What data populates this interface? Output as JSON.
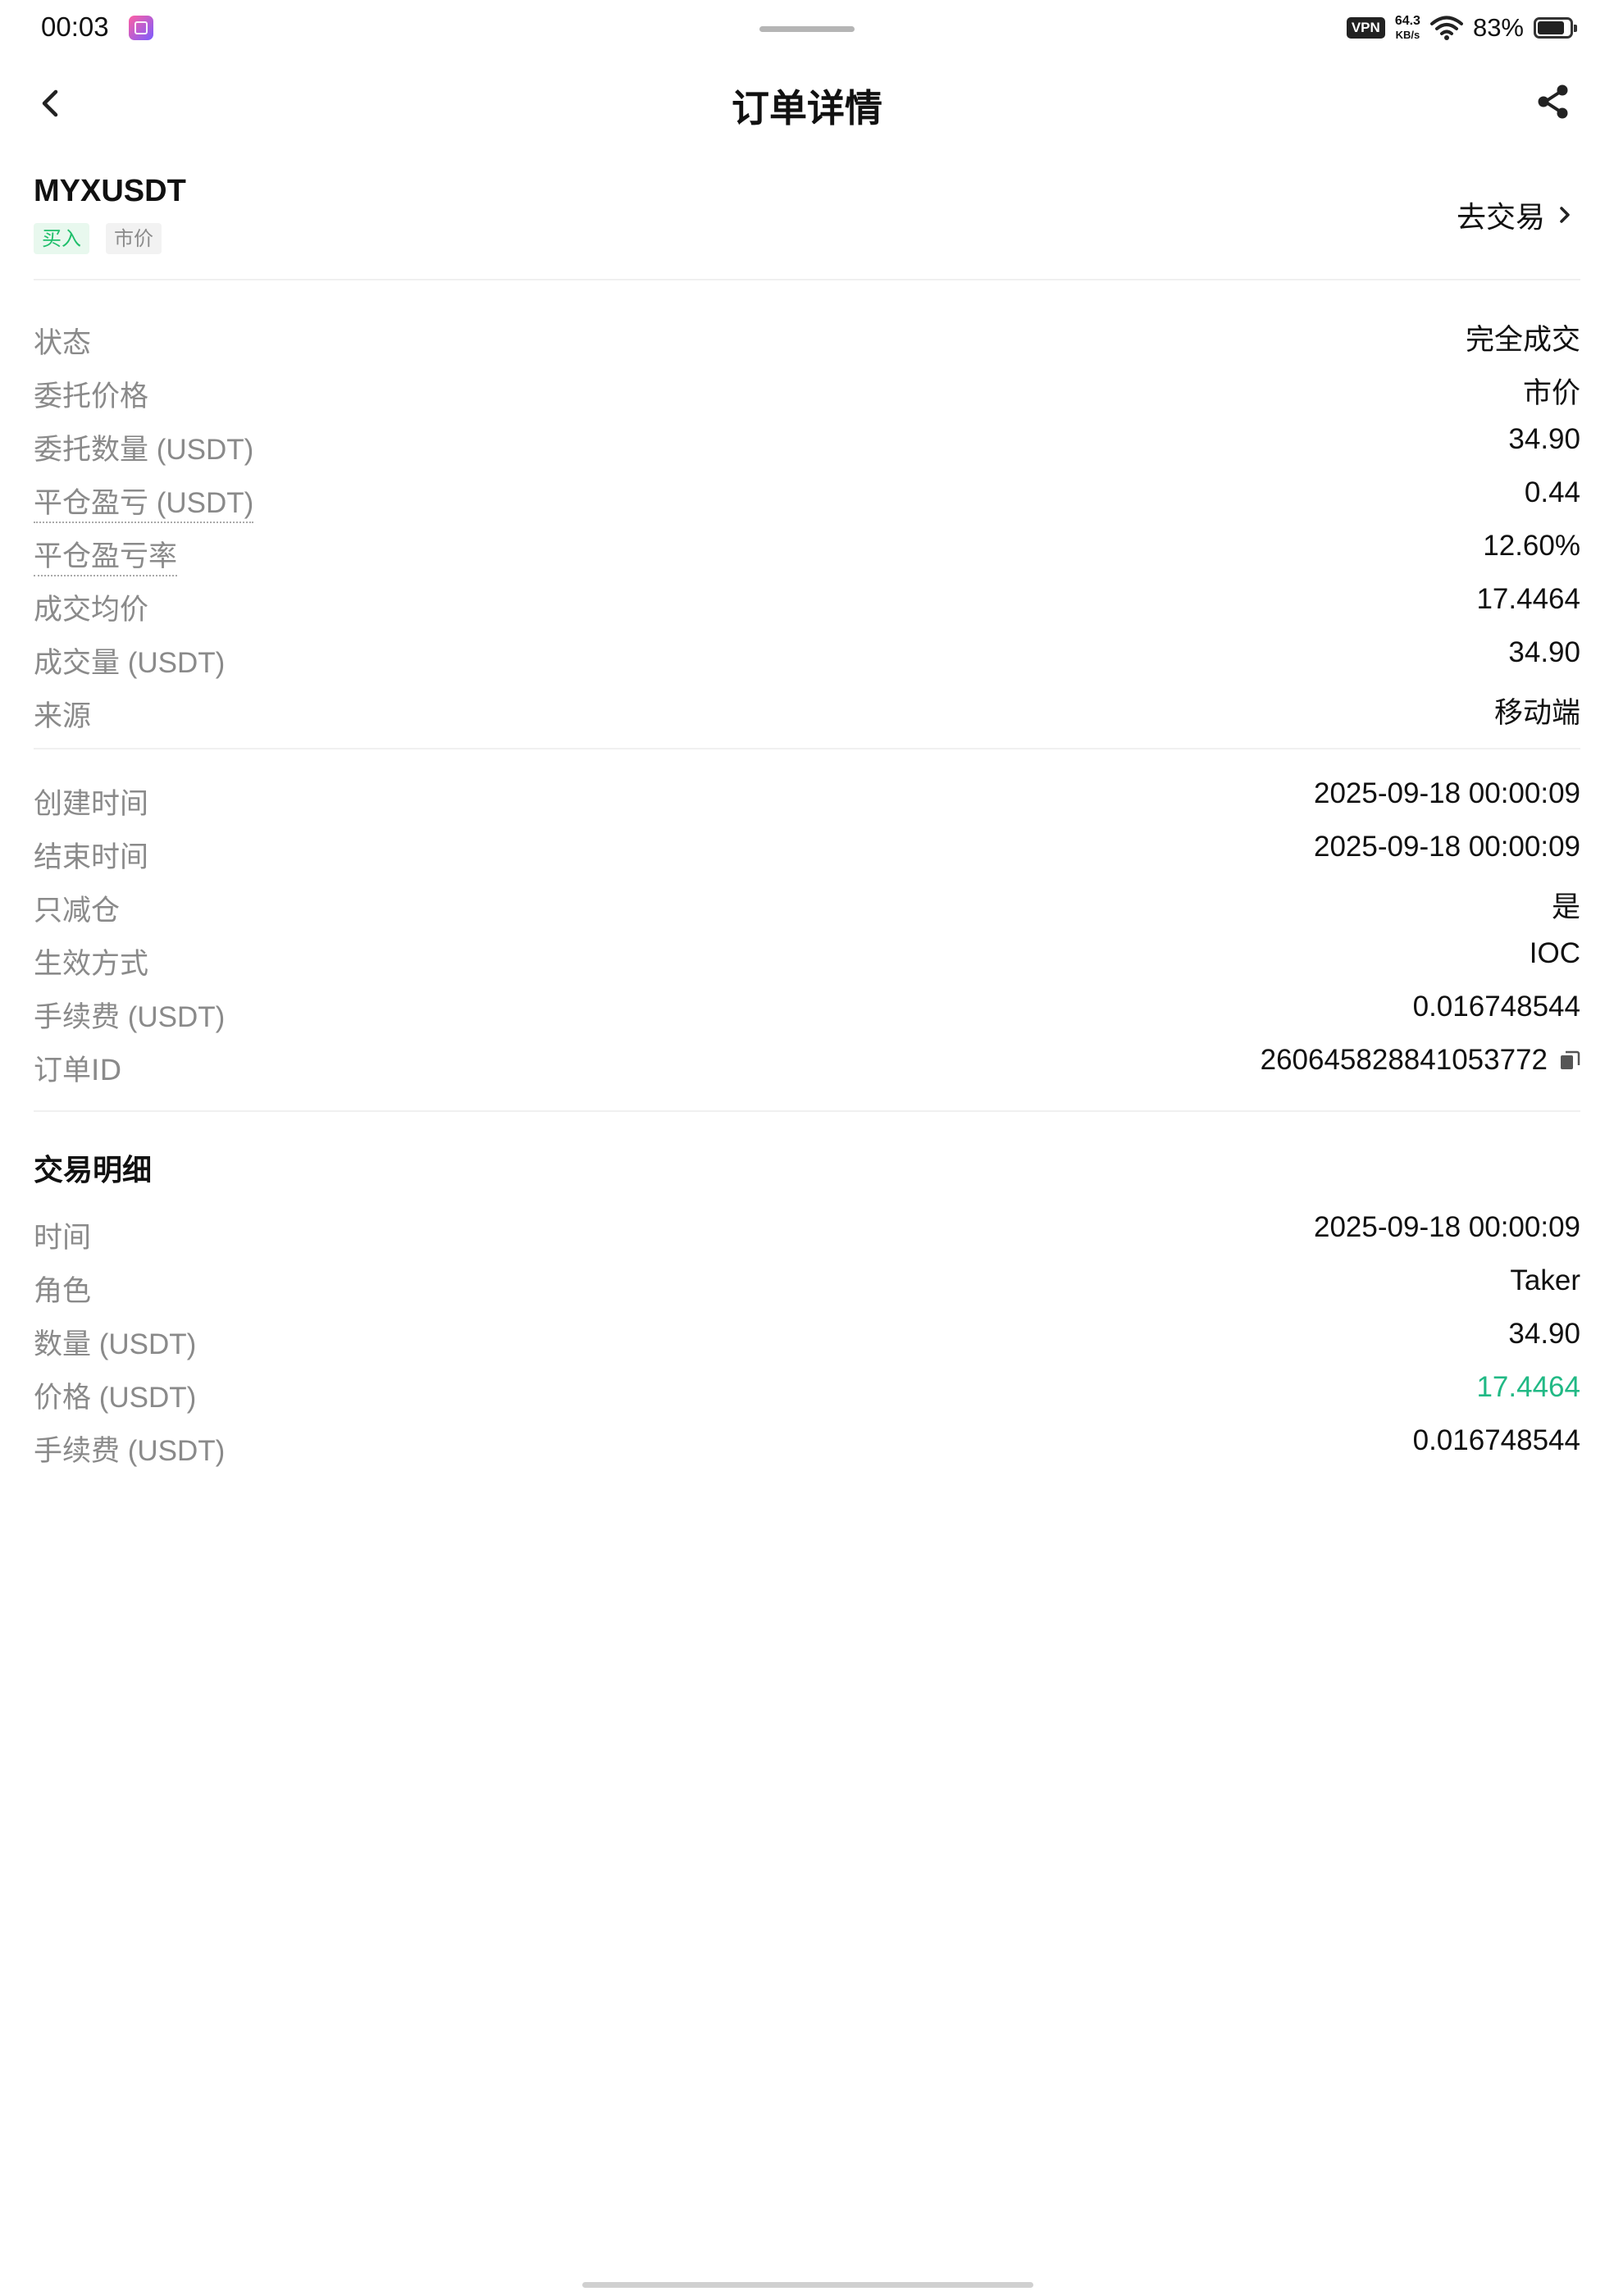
{
  "status_bar": {
    "time": "00:03",
    "vpn": "VPN",
    "net_speed_value": "64.3",
    "net_speed_unit": "KB/s",
    "battery_text": "83%",
    "battery_level": 0.83,
    "icons": [
      "app-notification-icon",
      "wifi-icon",
      "battery-icon"
    ]
  },
  "nav": {
    "title": "订单详情",
    "back_icon": "chevron-left-icon",
    "share_icon": "share-icon"
  },
  "order": {
    "symbol": "MYXUSDT",
    "side_tag": "买入",
    "type_tag": "市价",
    "go_trade": "去交易"
  },
  "details": [
    {
      "label": "状态",
      "unit": "",
      "value": "完全成交",
      "dotted": false
    },
    {
      "label": "委托价格",
      "unit": "",
      "value": "市价",
      "dotted": false
    },
    {
      "label": "委托数量",
      "unit": " (USDT)",
      "value": "34.90",
      "dotted": false
    },
    {
      "label": "平仓盈亏",
      "unit": " (USDT)",
      "value": "0.44",
      "dotted": true
    },
    {
      "label": "平仓盈亏率",
      "unit": "",
      "value": "12.60%",
      "dotted": true
    },
    {
      "label": "成交均价",
      "unit": "",
      "value": "17.4464",
      "dotted": false
    },
    {
      "label": "成交量",
      "unit": " (USDT)",
      "value": "34.90",
      "dotted": false
    },
    {
      "label": "来源",
      "unit": "",
      "value": "移动端",
      "dotted": false
    }
  ],
  "meta": [
    {
      "label": "创建时间",
      "unit": "",
      "value": "2025-09-18 00:00:09"
    },
    {
      "label": "结束时间",
      "unit": "",
      "value": "2025-09-18 00:00:09"
    },
    {
      "label": "只减仓",
      "unit": "",
      "value": "是"
    },
    {
      "label": "生效方式",
      "unit": "",
      "value": "IOC"
    },
    {
      "label": "手续费",
      "unit": " (USDT)",
      "value": "0.016748544"
    },
    {
      "label": "订单ID",
      "unit": "",
      "value": "260645828841053772"
    }
  ],
  "trade_detail": {
    "title": "交易明细",
    "rows": [
      {
        "label": "时间",
        "unit": "",
        "value": "2025-09-18 00:00:09"
      },
      {
        "label": "角色",
        "unit": "",
        "value": "Taker"
      },
      {
        "label": "数量",
        "unit": " (USDT)",
        "value": "34.90"
      },
      {
        "label": "价格",
        "unit": " (USDT)",
        "value": "17.4464"
      },
      {
        "label": "手续费",
        "unit": " (USDT)",
        "value": "0.016748544"
      }
    ]
  },
  "colors": {
    "buy_green": "#1fbf6b",
    "price_green": "#21b985",
    "label_gray": "#8a8a8a",
    "text": "#111111"
  }
}
